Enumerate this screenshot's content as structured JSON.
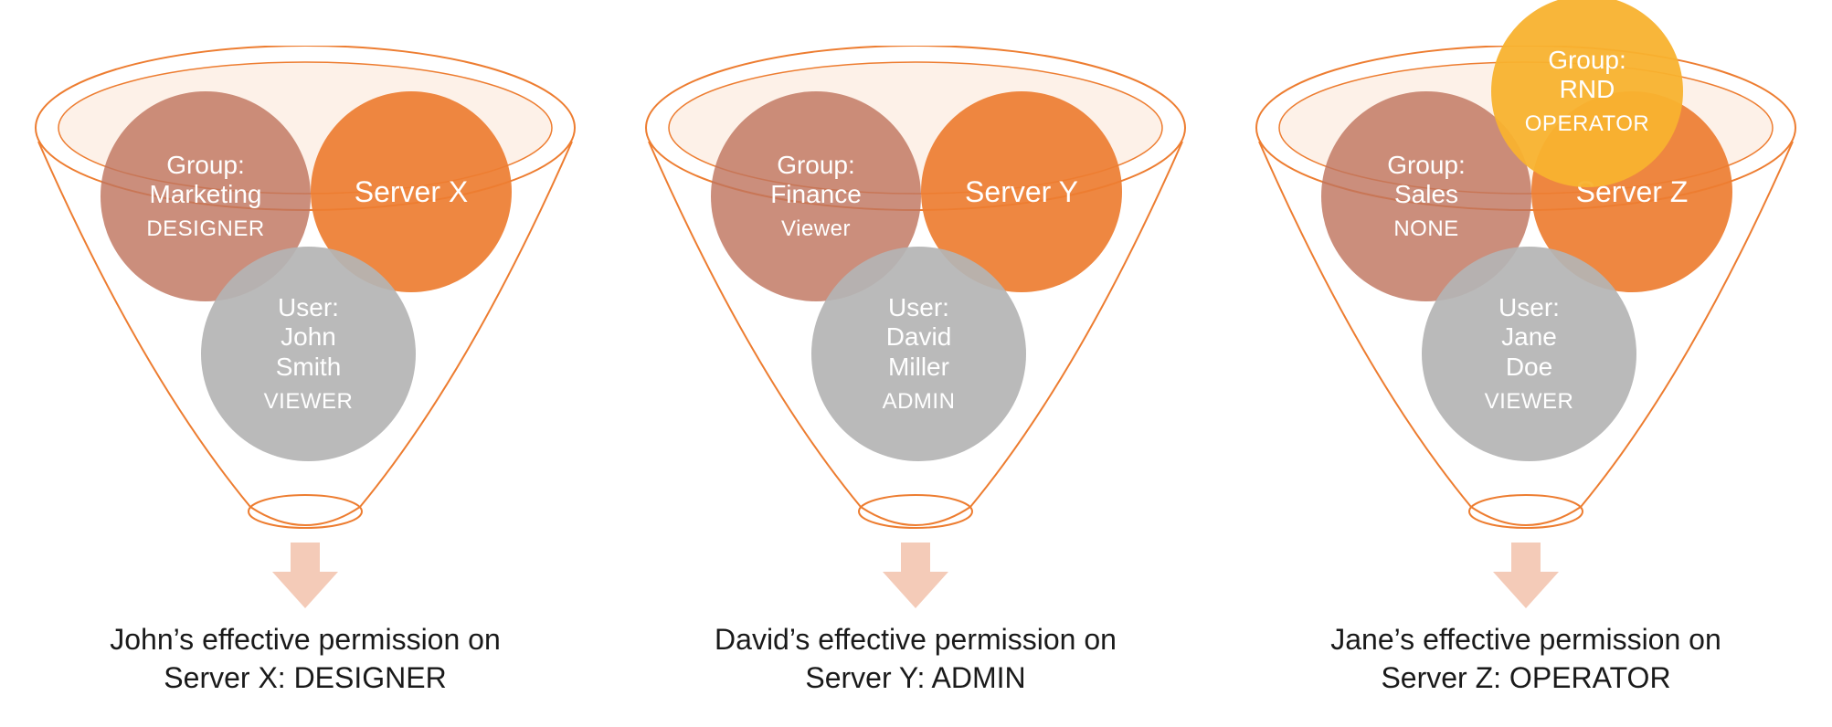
{
  "colors": {
    "funnel_stroke": "#ed7d31",
    "funnel_fill": "#fbe5d6",
    "arrow_fill": "#f4cbb8",
    "group_bubble": "#c0755f",
    "server_bubble": "#ed7d31",
    "user_bubble": "#b4b4b4",
    "extra_bubble": "#f8b22f"
  },
  "funnels": [
    {
      "id": "funnel-john",
      "group": {
        "line1": "Group:",
        "line2": "Marketing",
        "role": "DESIGNER"
      },
      "server": {
        "line1": "Server X"
      },
      "user": {
        "line1": "User:",
        "line2": "John",
        "line3": "Smith",
        "role": "VIEWER"
      },
      "extra": null,
      "caption_line1": "John’s effective permission on",
      "caption_line2": "Server X: DESIGNER"
    },
    {
      "id": "funnel-david",
      "group": {
        "line1": "Group:",
        "line2": "Finance",
        "role": "Viewer"
      },
      "server": {
        "line1": "Server Y"
      },
      "user": {
        "line1": "User:",
        "line2": "David",
        "line3": "Miller",
        "role": "ADMIN"
      },
      "extra": null,
      "caption_line1": "David’s effective permission on",
      "caption_line2": "Server Y: ADMIN"
    },
    {
      "id": "funnel-jane",
      "group": {
        "line1": "Group:",
        "line2": "Sales",
        "role": "NONE"
      },
      "server": {
        "line1": "Server Z"
      },
      "user": {
        "line1": "User:",
        "line2": "Jane",
        "line3": "Doe",
        "role": "VIEWER"
      },
      "extra": {
        "line1": "Group:",
        "line2": "RND",
        "role": "OPERATOR"
      },
      "caption_line1": "Jane’s effective permission on",
      "caption_line2": "Server Z: OPERATOR"
    }
  ]
}
